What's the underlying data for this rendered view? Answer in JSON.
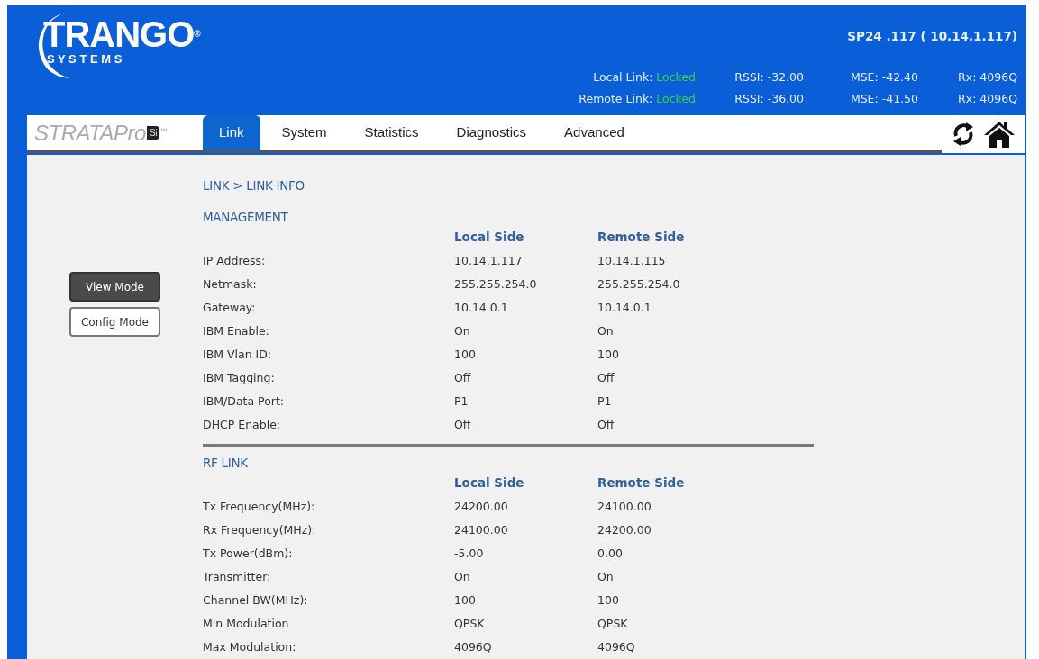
{
  "logo": {
    "brand": "TRANGO",
    "registered": "®",
    "tagline": "S Y S T E M S"
  },
  "device": {
    "title": "SP24 .117 ( 10.14.1.117)"
  },
  "link_status": [
    {
      "label": "Local Link:",
      "status": "Locked",
      "rssi": "RSSI: -32.00",
      "mse": "MSE: -42.40",
      "rx": "Rx: 4096Q"
    },
    {
      "label": "Remote Link:",
      "status": "Locked",
      "rssi": "RSSI: -36.00",
      "mse": "MSE: -41.50",
      "rx": "Rx: 4096Q"
    }
  ],
  "product": {
    "name": "STRATAPro",
    "badge": "Si",
    "trademark": "™"
  },
  "tabs": [
    {
      "label": "Link",
      "selected": true
    },
    {
      "label": "System",
      "selected": false
    },
    {
      "label": "Statistics",
      "selected": false
    },
    {
      "label": "Diagnostics",
      "selected": false
    },
    {
      "label": "Advanced",
      "selected": false
    }
  ],
  "mode_buttons": [
    {
      "label": "View Mode",
      "selected": true
    },
    {
      "label": "Config Mode",
      "selected": false
    }
  ],
  "breadcrumb": "LINK > LINK INFO",
  "sections": [
    {
      "title": "MANAGEMENT",
      "columns": [
        "Local Side",
        "Remote Side"
      ],
      "rows": [
        {
          "label": "IP Address:",
          "local": "10.14.1.117",
          "remote": "10.14.1.115"
        },
        {
          "label": "Netmask:",
          "local": "255.255.254.0",
          "remote": "255.255.254.0"
        },
        {
          "label": "Gateway:",
          "local": "10.14.0.1",
          "remote": "10.14.0.1"
        },
        {
          "label": "IBM Enable:",
          "local": "On",
          "remote": "On"
        },
        {
          "label": "IBM Vlan ID:",
          "local": "100",
          "remote": "100"
        },
        {
          "label": "IBM Tagging:",
          "local": "Off",
          "remote": "Off"
        },
        {
          "label": "IBM/Data Port:",
          "local": "P1",
          "remote": "P1"
        },
        {
          "label": "DHCP Enable:",
          "local": "Off",
          "remote": "Off"
        }
      ]
    },
    {
      "title": "RF LINK",
      "columns": [
        "Local Side",
        "Remote Side"
      ],
      "rows": [
        {
          "label": "Tx Frequency(MHz):",
          "local": "24200.00",
          "remote": "24100.00"
        },
        {
          "label": "Rx Frequency(MHz):",
          "local": "24100.00",
          "remote": "24200.00"
        },
        {
          "label": "Tx Power(dBm):",
          "local": "-5.00",
          "remote": "0.00"
        },
        {
          "label": "Transmitter:",
          "local": "On",
          "remote": "On"
        },
        {
          "label": "Channel BW(MHz):",
          "local": "100",
          "remote": "100"
        },
        {
          "label": "Min Modulation",
          "local": "QPSK",
          "remote": "QPSK"
        },
        {
          "label": "Max Modulation:",
          "local": "4096Q",
          "remote": "4096Q"
        }
      ]
    }
  ]
}
